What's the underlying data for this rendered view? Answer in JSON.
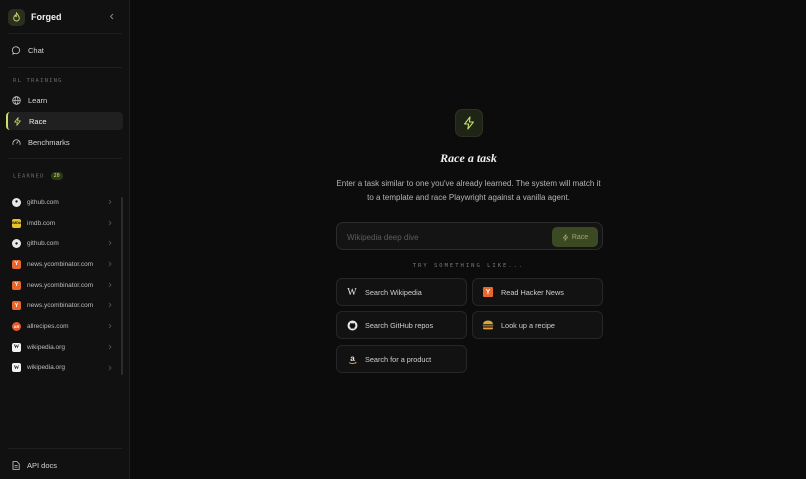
{
  "app": {
    "name": "Forged"
  },
  "sidebar": {
    "chat_label": "Chat",
    "rl_section_label": "RL TRAINING",
    "nav": [
      {
        "label": "Learn",
        "icon": "globe-icon"
      },
      {
        "label": "Race",
        "icon": "bolt-icon",
        "active": true
      },
      {
        "label": "Benchmarks",
        "icon": "gauge-icon"
      }
    ],
    "learned_label": "LEARNED",
    "learned_count": "20",
    "learned": [
      {
        "domain": "github.com",
        "icon": "github-icon"
      },
      {
        "domain": "imdb.com",
        "icon": "imdb-icon"
      },
      {
        "domain": "github.com",
        "icon": "github-icon"
      },
      {
        "domain": "news.ycombinator.com",
        "icon": "ycombinator-icon"
      },
      {
        "domain": "news.ycombinator.com",
        "icon": "ycombinator-icon"
      },
      {
        "domain": "news.ycombinator.com",
        "icon": "ycombinator-icon"
      },
      {
        "domain": "allrecipes.com",
        "icon": "allrecipes-icon"
      },
      {
        "domain": "wikipedia.org",
        "icon": "wikipedia-icon"
      },
      {
        "domain": "wikipedia.org",
        "icon": "wikipedia-icon"
      }
    ],
    "api_docs_label": "API docs"
  },
  "main": {
    "title": "Race a task",
    "subtitle": "Enter a task similar to one you've already learned. The system will match it to a template and race Playwright against a vanilla agent.",
    "input_placeholder": "Wikipedia deep dive",
    "race_button": "Race",
    "try_label": "TRY SOMETHING LIKE...",
    "suggestions": [
      {
        "label": "Search Wikipedia",
        "icon": "wikipedia-icon"
      },
      {
        "label": "Read Hacker News",
        "icon": "ycombinator-icon"
      },
      {
        "label": "Search GitHub repos",
        "icon": "github-icon"
      },
      {
        "label": "Look up a recipe",
        "icon": "burger-icon"
      },
      {
        "label": "Search for a product",
        "icon": "amazon-icon"
      }
    ]
  },
  "colors": {
    "accent": "#c6e06a",
    "background": "#0c0c0c",
    "sidebar": "#111111"
  }
}
